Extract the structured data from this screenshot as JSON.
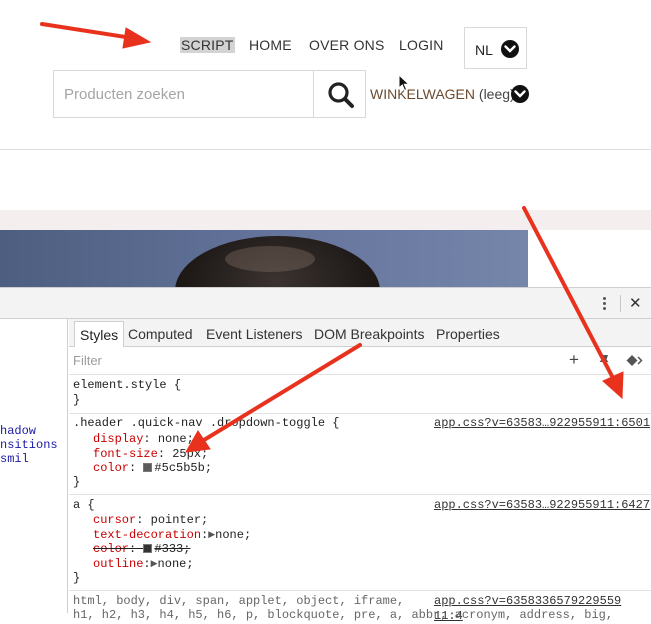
{
  "header": {
    "nav": [
      "SCRIPT",
      "HOME",
      "OVER ONS",
      "LOGIN"
    ],
    "language": "NL",
    "search_placeholder": "Producten zoeken",
    "cart_label": "WINKELWAGEN",
    "cart_count": "(leeg)"
  },
  "devtools": {
    "dom_lines": [
      "hadow",
      "nsitions",
      "smil"
    ],
    "tabs": [
      "Styles",
      "Computed",
      "Event Listeners",
      "DOM Breakpoints",
      "Properties"
    ],
    "active_tab": "Styles",
    "filter_placeholder": "Filter",
    "toolbar_add": "+",
    "close": "✕",
    "rules": {
      "element_style": {
        "selector": "element.style {",
        "close": "}"
      },
      "toggle": {
        "selector": ".header .quick-nav .dropdown-toggle {",
        "source": "app.css?v=63583…922955911:6501",
        "props": [
          {
            "name": "display",
            "value": "none;"
          },
          {
            "name": "font-size",
            "value": "25px;"
          },
          {
            "name": "color",
            "value": "#5c5b5b;",
            "swatch": "#5c5b5b"
          }
        ],
        "close": "}"
      },
      "anchor": {
        "selector": "a {",
        "source": "app.css?v=63583…922955911:6427",
        "props": [
          {
            "name": "cursor",
            "value": "pointer;"
          },
          {
            "name": "text-decoration",
            "value": "none;"
          },
          {
            "name": "color",
            "value": "#333;",
            "swatch": "#333333"
          },
          {
            "name": "outline",
            "value": "none;"
          }
        ],
        "close": "}"
      },
      "reset": {
        "selector_line1": "html, body, div, span, applet, object, iframe,",
        "selector_line2": "h1, h2, h3, h4, h5, h6, p, blockquote, pre, a, abbr, acronym, address, big,",
        "source": "app.css?v=6358336579229559 11:4"
      }
    }
  },
  "colors": {
    "annotation_arrow": "#e8321e",
    "cart_link": "#6b4a2f",
    "css_property": "#c80000"
  }
}
